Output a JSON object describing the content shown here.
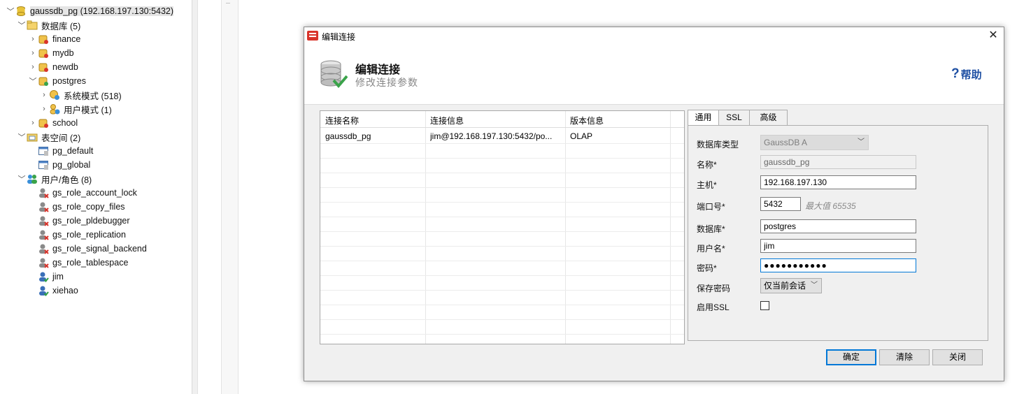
{
  "tree": {
    "root": "gaussdb_pg (192.168.197.130:5432)",
    "databases_label": "数据库 (5)",
    "databases": [
      "finance",
      "mydb",
      "newdb",
      "postgres"
    ],
    "schemas": [
      "系统模式 (518)",
      "用户模式 (1)"
    ],
    "db_school": "school",
    "tablespaces_label": "表空间 (2)",
    "tablespaces": [
      "pg_default",
      "pg_global"
    ],
    "users_label": "用户/角色 (8)",
    "roles": [
      "gs_role_account_lock",
      "gs_role_copy_files",
      "gs_role_pldebugger",
      "gs_role_replication",
      "gs_role_signal_backend",
      "gs_role_tablespace"
    ],
    "users": [
      "jim",
      "xiehao"
    ]
  },
  "dialog": {
    "window_title": "编辑连接",
    "close_glyph": "✕",
    "header_title": "编辑连接",
    "header_subtitle": "修改连接参数",
    "help_label": "帮助",
    "help_glyph": "?",
    "table": {
      "columns": [
        "连接名称",
        "连接信息",
        "版本信息"
      ],
      "rows": [
        [
          "gaussdb_pg",
          "jim@192.168.197.130:5432/po...",
          "OLAP"
        ]
      ]
    },
    "tabs": [
      "通用",
      "SSL",
      "高级"
    ],
    "form": {
      "db_type_label": "数据库类型",
      "db_type_value": "GaussDB A",
      "name_label": "名称*",
      "name_value": "gaussdb_pg",
      "host_label": "主机*",
      "host_value": "192.168.197.130",
      "port_label": "端口号*",
      "port_value": "5432",
      "port_hint": "最大值 65535",
      "database_label": "数据库*",
      "database_value": "postgres",
      "username_label": "用户名*",
      "username_value": "jim",
      "password_label": "密码*",
      "password_value": "●●●●●●●●●●●",
      "save_password_label": "保存密码",
      "save_password_value": "仅当前会话",
      "ssl_label": "启用SSL"
    },
    "buttons": {
      "ok": "确定",
      "clear": "清除",
      "close": "关闭"
    }
  }
}
